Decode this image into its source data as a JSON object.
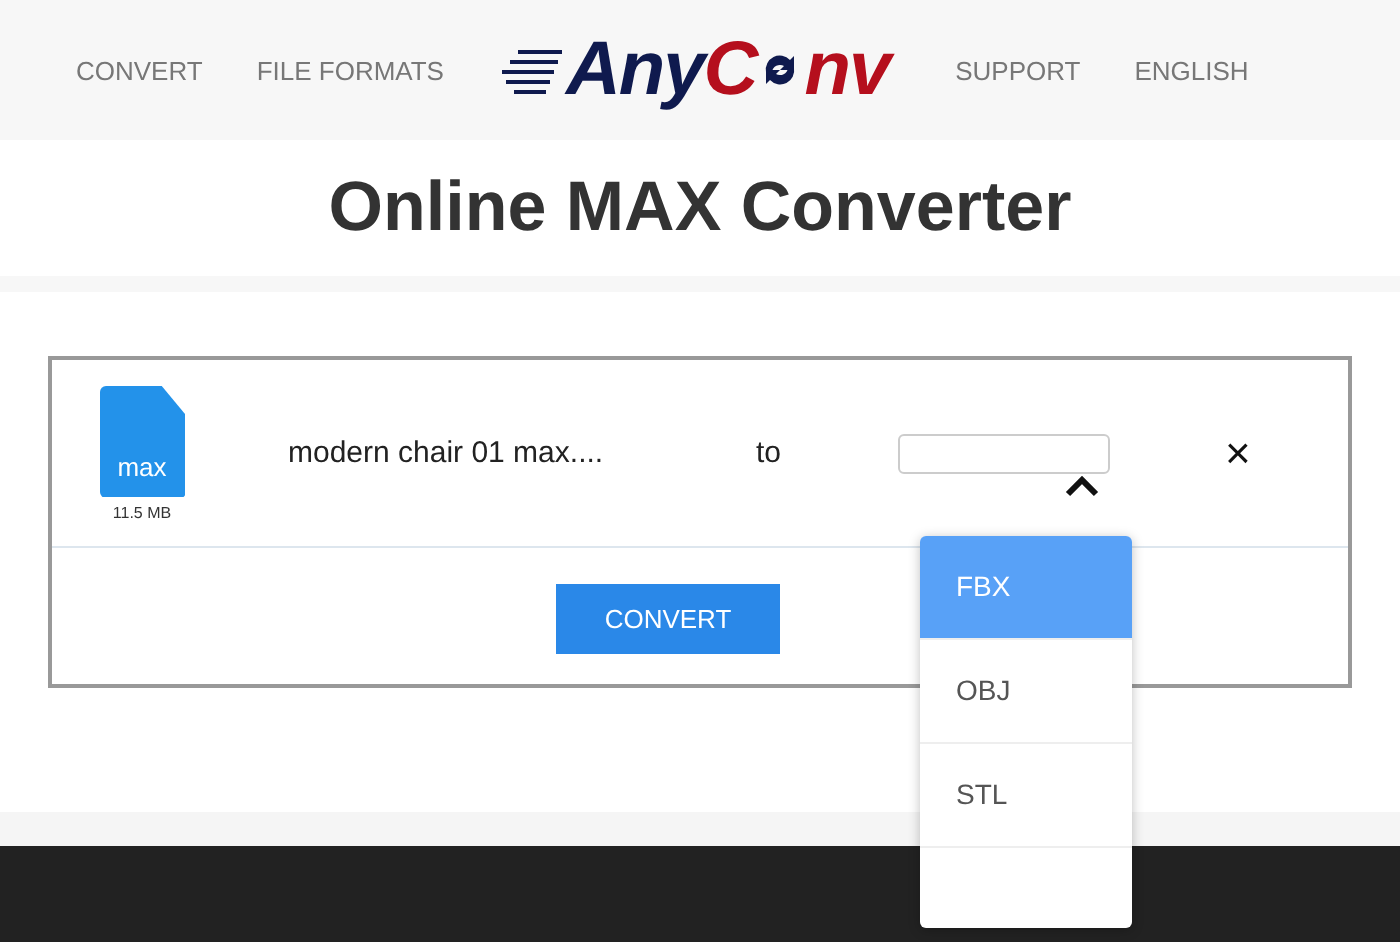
{
  "nav": {
    "left": [
      {
        "label": "CONVERT"
      },
      {
        "label": "FILE FORMATS"
      }
    ],
    "right": [
      {
        "label": "SUPPORT"
      },
      {
        "label": "ENGLISH"
      }
    ]
  },
  "logo": {
    "first": "Any",
    "second_start": "C",
    "second_end": "nv"
  },
  "title": "Online MAX Converter",
  "file": {
    "badge": "max",
    "size": "11.5 MB",
    "name": "modern chair 01 max....",
    "to": "to",
    "close": "×"
  },
  "convert_button": "CONVERT",
  "dropdown": [
    {
      "label": "FBX",
      "selected": true
    },
    {
      "label": "OBJ",
      "selected": false
    },
    {
      "label": "STL",
      "selected": false
    }
  ]
}
